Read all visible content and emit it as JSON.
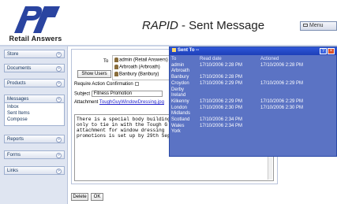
{
  "header": {
    "logo_text": "Retail Answers",
    "title_italic": "RAPID",
    "title_rest": " - Sent Message",
    "menu_label": "Menu"
  },
  "sidebar": {
    "sections": [
      {
        "label": "Store",
        "items": []
      },
      {
        "label": "Documents",
        "items": []
      },
      {
        "label": "Products",
        "items": []
      },
      {
        "label": "Messages",
        "items": [
          "Inbox",
          "Sent Items",
          "Compose"
        ]
      },
      {
        "label": "Reports",
        "items": []
      },
      {
        "label": "Forms",
        "items": []
      },
      {
        "label": "Links",
        "items": []
      }
    ]
  },
  "message": {
    "to_label": "To",
    "show_users_label": "Show Users",
    "recipients": [
      "admin (Retail Answers)",
      "Arbroath (Arbroath)",
      "Banbury (Banbury)"
    ],
    "require_label": "Require Action Confirmation",
    "subject_label": "Subject",
    "subject_value": "Fitness Promotion",
    "attachment_label": "Attachment",
    "attachment_value": "ToughGuyWindowDressing.jpg",
    "body_lines": [
      "There is a special body building",
      "only to tie in with the Tough G",
      "attachment for window dressing",
      "promotions is set up by 29th Sep"
    ],
    "delete_label": "Delete",
    "ok_label": "OK"
  },
  "popup": {
    "title": "Sent To --",
    "headers": {
      "to": "To",
      "read": "Read date",
      "actioned": "Actioned"
    },
    "rows": [
      {
        "to": "admin",
        "read": "17/10/2006 2:28 PM",
        "actioned": "17/10/2006 2:28 PM"
      },
      {
        "to": "Arbroath",
        "read": "",
        "actioned": ""
      },
      {
        "to": "Banbury",
        "read": "17/10/2006 2:28 PM",
        "actioned": ""
      },
      {
        "to": "Croydon",
        "read": "17/10/2006 2:29 PM",
        "actioned": "17/10/2006 2:29 PM"
      },
      {
        "to": "Derby",
        "read": "",
        "actioned": ""
      },
      {
        "to": "Ireland",
        "read": "",
        "actioned": ""
      },
      {
        "to": "Kilkenny",
        "read": "17/10/2006 2:29 PM",
        "actioned": "17/10/2006 2:29 PM"
      },
      {
        "to": "London",
        "read": "17/10/2006 2:30 PM",
        "actioned": "17/10/2006 2:30 PM"
      },
      {
        "to": "Midlands",
        "read": "",
        "actioned": ""
      },
      {
        "to": "Scotland",
        "read": "17/10/2006 2:34 PM",
        "actioned": ""
      },
      {
        "to": "Wales",
        "read": "17/10/2006 2:34 PM",
        "actioned": ""
      },
      {
        "to": "York",
        "read": "",
        "actioned": ""
      }
    ]
  },
  "colors": {
    "popup_bg": "#5b73c4",
    "popup_title": "#1d3fb8",
    "sidebar_bg": "#dfe5f1",
    "logo_blue": "#2a44a0"
  }
}
